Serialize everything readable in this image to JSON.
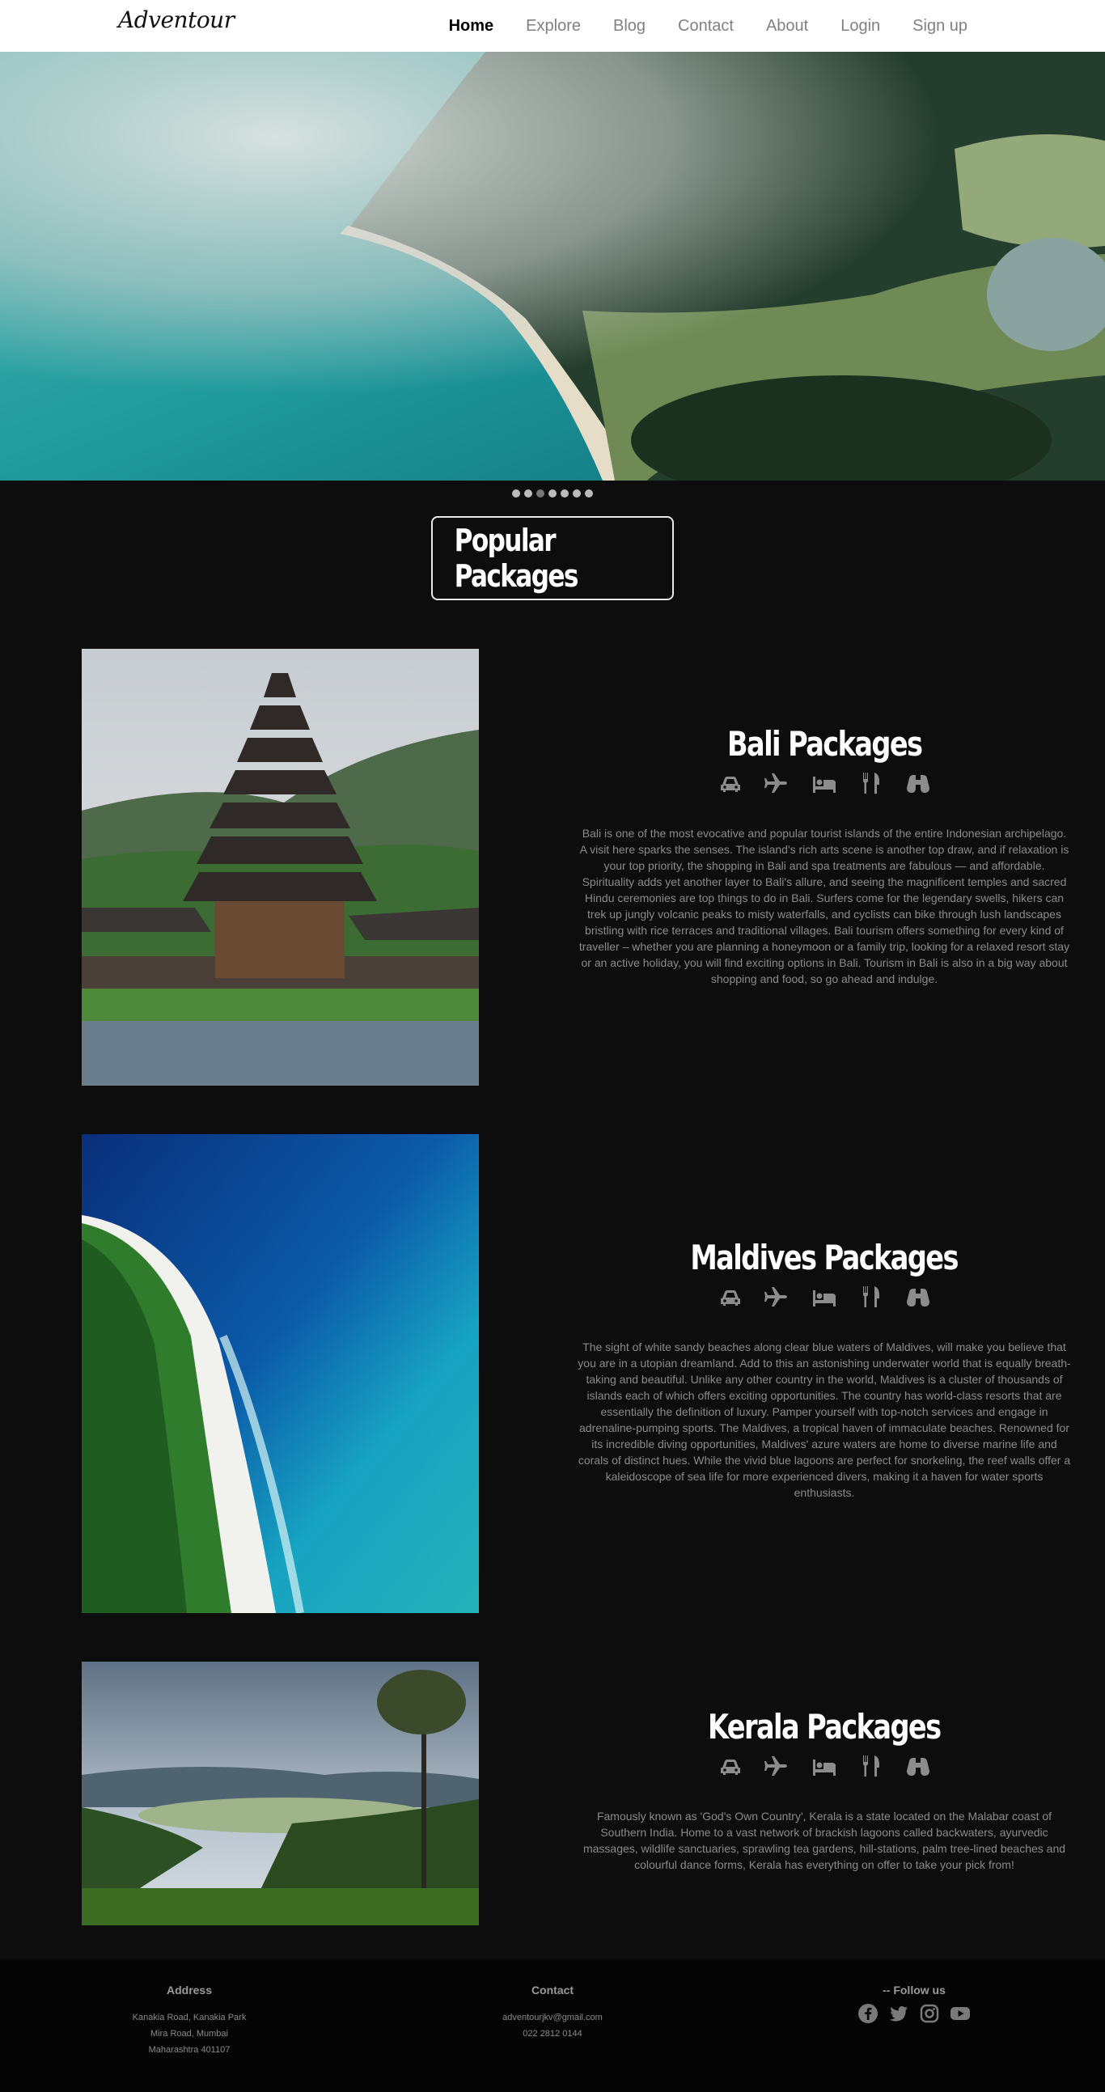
{
  "nav": {
    "logo": "Adventour",
    "links": [
      "Home",
      "Explore",
      "Blog",
      "Contact",
      "About",
      "Login",
      "Sign up"
    ]
  },
  "carousel": {
    "slides": 7,
    "active_index": 2
  },
  "section_title": "Popular Packages",
  "packages": [
    {
      "title": "Bali Packages",
      "icons": [
        "car-icon",
        "plane-icon",
        "bed-icon",
        "utensils-icon",
        "binoculars-icon"
      ],
      "description": "Bali is one of the most evocative and popular tourist islands of the entire Indonesian archipelago. A visit here sparks the senses. The island's rich arts scene is another top draw, and if relaxation is your top priority, the shopping in Bali and spa treatments are fabulous — and affordable. Spirituality adds yet another layer to Bali's allure, and seeing the magnificent temples and sacred Hindu ceremonies are top things to do in Bali. Surfers come for the legendary swells, hikers can trek up jungly volcanic peaks to misty waterfalls, and cyclists can bike through lush landscapes bristling with rice terraces and traditional villages. Bali tourism offers something for every kind of traveller – whether you are planning a honeymoon or a family trip, looking for a relaxed resort stay or an active holiday, you will find exciting options in Bali. Tourism in Bali is also in a big way about shopping and food, so go ahead and indulge."
    },
    {
      "title": "Maldives Packages",
      "icons": [
        "car-icon",
        "plane-icon",
        "bed-icon",
        "utensils-icon",
        "binoculars-icon"
      ],
      "description": "The sight of white sandy beaches along clear blue waters of Maldives, will make you believe that you are in a utopian dreamland. Add to this an astonishing underwater world that is equally breath-taking and beautiful. Unlike any other country in the world, Maldives is a cluster of thousands of islands each of which offers exciting opportunities. The country has world-class resorts that are essentially the definition of luxury. Pamper yourself with top-notch services and engage in adrenaline-pumping sports. The Maldives, a tropical haven of immaculate beaches. Renowned for its incredible diving opportunities, Maldives' azure waters are home to diverse marine life and corals of distinct hues. While the vivid blue lagoons are perfect for snorkeling, the reef walls offer a kaleidoscope of sea life for more experienced divers, making it a haven for water sports enthusiasts."
    },
    {
      "title": "Kerala Packages",
      "icons": [
        "car-icon",
        "plane-icon",
        "bed-icon",
        "utensils-icon",
        "binoculars-icon"
      ],
      "description": "Famously known as 'God's Own Country', Kerala is a state located on the Malabar coast of Southern India. Home to a vast network of brackish lagoons called backwaters, ayurvedic massages, wildlife sanctuaries, sprawling tea gardens, hill-stations, palm tree-lined beaches and colourful dance forms, Kerala has everything on offer to take your pick from!"
    }
  ],
  "footer": {
    "address": {
      "heading": "Address",
      "lines": [
        "Kanakia Road, Kanakia Park",
        "Mira Road, Mumbai",
        "Maharashtra 401107"
      ]
    },
    "contact": {
      "heading": "Contact",
      "lines": [
        "adventourjkv@gmail.com",
        "022 2812 0144"
      ]
    },
    "follow": {
      "heading": "-- Follow us",
      "icons": [
        "facebook-icon",
        "twitter-icon",
        "instagram-icon",
        "youtube-icon"
      ]
    }
  },
  "colors": {
    "background": "#0d0d0d",
    "nav_background": "#ffffff",
    "icon_gray": "#8c8c8c",
    "text_gray": "#8a8a8a"
  }
}
